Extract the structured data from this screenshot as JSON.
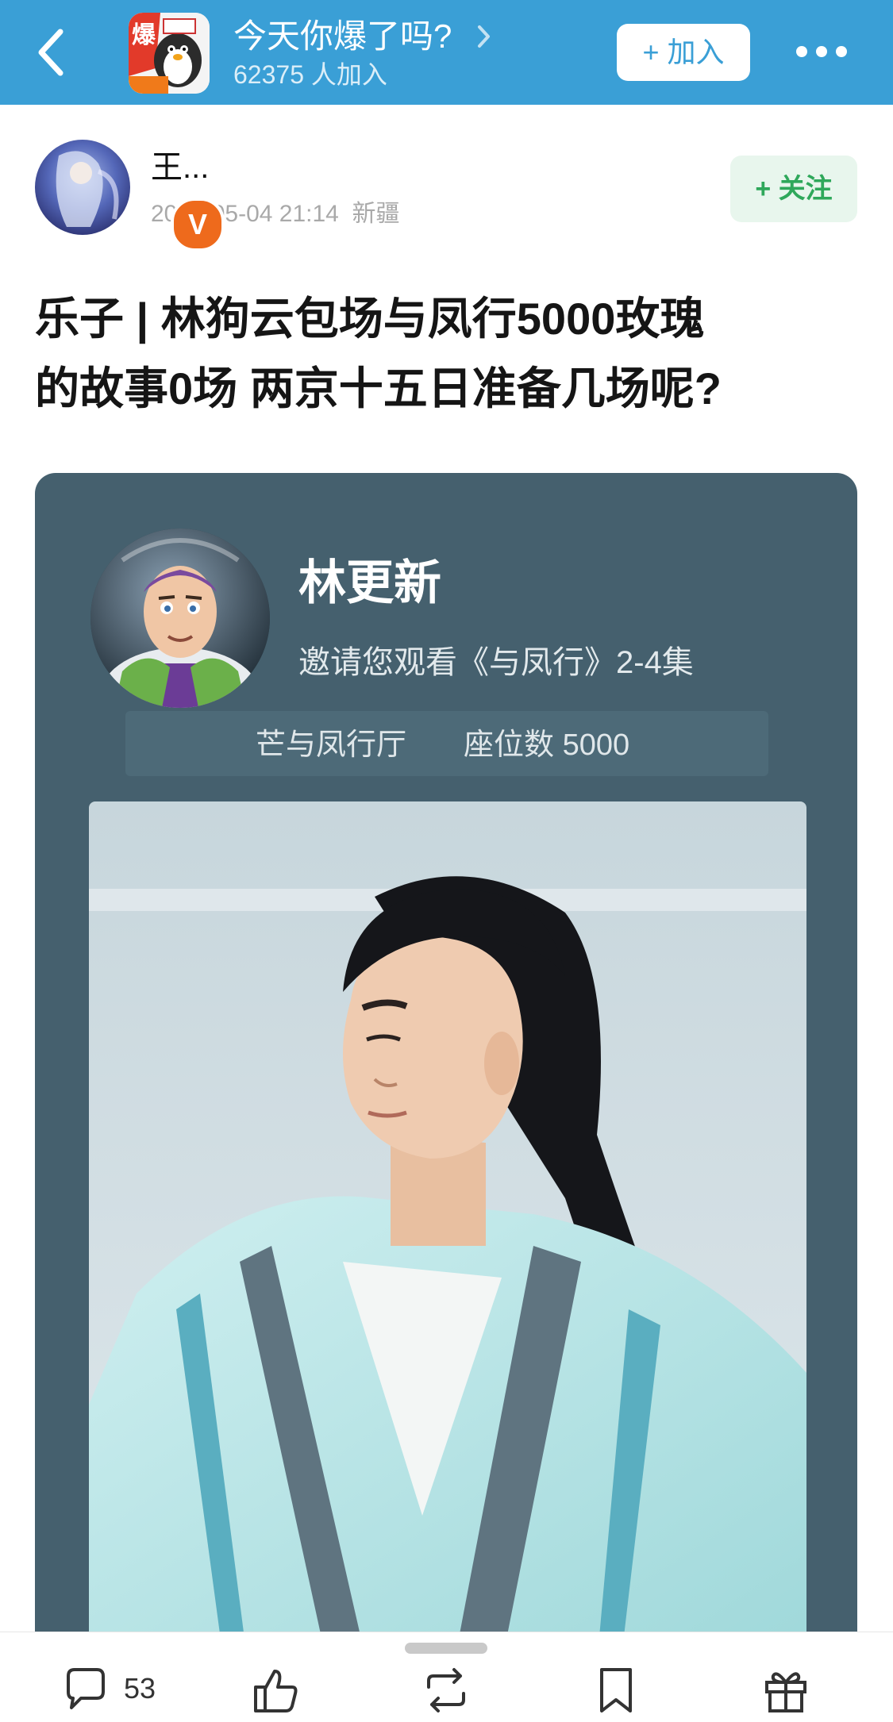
{
  "header": {
    "group_name": "今天你爆了吗?",
    "group_count": "62375 人加入",
    "join_label": "+ 加入"
  },
  "post": {
    "author": "王...",
    "time": "2026-05-04 21:14",
    "location": "新疆",
    "follow_label": "+ 关注",
    "title_line1": "乐子 | 林狗云包场与凤行5000玫瑰",
    "title_line2": "的故事0场 两京十五日准备几场呢?"
  },
  "card": {
    "name": "林更新",
    "invite": "邀请您观看《与凤行》2-4集",
    "verified_badge": "V",
    "hall": "芒与凤行厅",
    "seat_label": "座位数",
    "seat_value": "5000"
  },
  "toolbar": {
    "comment_count": "53"
  },
  "colors": {
    "header_bg": "#3a9fd6",
    "follow_text": "#2fa85b",
    "card_bg": "#45606e",
    "badge": "#ee6a1c"
  },
  "icons": [
    "back-arrow-icon",
    "chevron-right-icon",
    "more-dots-icon",
    "comment-icon",
    "like-icon",
    "repost-icon",
    "bookmark-icon",
    "gift-icon"
  ]
}
